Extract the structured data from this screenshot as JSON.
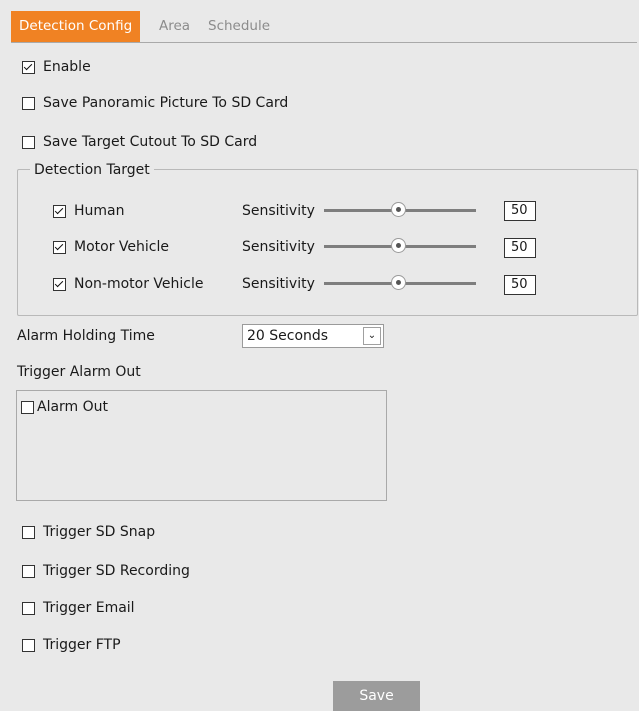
{
  "tabs": [
    {
      "label": "Detection Config"
    },
    {
      "label": "Area"
    },
    {
      "label": "Schedule"
    }
  ],
  "options": {
    "enable": {
      "label": "Enable",
      "checked": true
    },
    "save_panoramic": {
      "label": "Save Panoramic Picture To SD Card",
      "checked": false
    },
    "save_target": {
      "label": "Save Target Cutout To SD Card",
      "checked": false
    }
  },
  "detection_target": {
    "legend": "Detection Target",
    "sensitivity_label": "Sensitivity",
    "targets": [
      {
        "label": "Human",
        "checked": true,
        "value": "50"
      },
      {
        "label": "Motor Vehicle",
        "checked": true,
        "value": "50"
      },
      {
        "label": "Non-motor Vehicle",
        "checked": true,
        "value": "50"
      }
    ]
  },
  "alarm_holding": {
    "label": "Alarm Holding Time",
    "value": "20 Seconds"
  },
  "trigger_alarm_out": {
    "label": "Trigger Alarm Out",
    "items": [
      {
        "label": "Alarm Out",
        "checked": false
      }
    ]
  },
  "triggers": [
    {
      "label": "Trigger SD Snap",
      "checked": false
    },
    {
      "label": "Trigger SD Recording",
      "checked": false
    },
    {
      "label": "Trigger Email",
      "checked": false
    },
    {
      "label": "Trigger FTP",
      "checked": false
    }
  ],
  "save_label": "Save",
  "colors": {
    "accent": "#f08223",
    "background": "#e9e9e9",
    "button": "#9c9c9c"
  }
}
